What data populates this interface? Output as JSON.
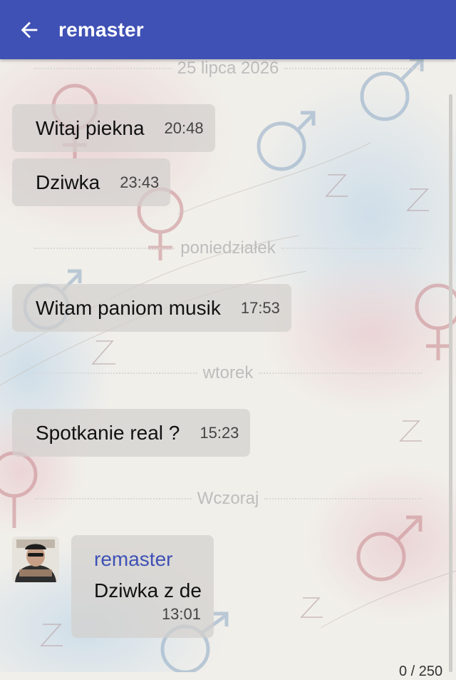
{
  "header": {
    "title": "remaster",
    "back_icon": "arrow-left-icon",
    "color": "#3f51b5"
  },
  "chat": {
    "sections": [
      {
        "date": "25 lipca 2026",
        "messages": [
          {
            "text": "Witaj piekna",
            "time": "20:48"
          },
          {
            "text": "Dziwka",
            "time": "23:43"
          }
        ]
      },
      {
        "date": "poniedziałek",
        "messages": [
          {
            "text": "Witam paniom musik",
            "time": "17:53"
          }
        ]
      },
      {
        "date": "wtorek",
        "messages": [
          {
            "text": "Spotkanie real ?",
            "time": "15:23"
          }
        ]
      },
      {
        "date": "Wczoraj",
        "messages": [
          {
            "sender": "remaster",
            "text": "Dziwka z de",
            "time": "13:01"
          }
        ]
      }
    ]
  },
  "footer": {
    "counter": "0 / 250"
  }
}
